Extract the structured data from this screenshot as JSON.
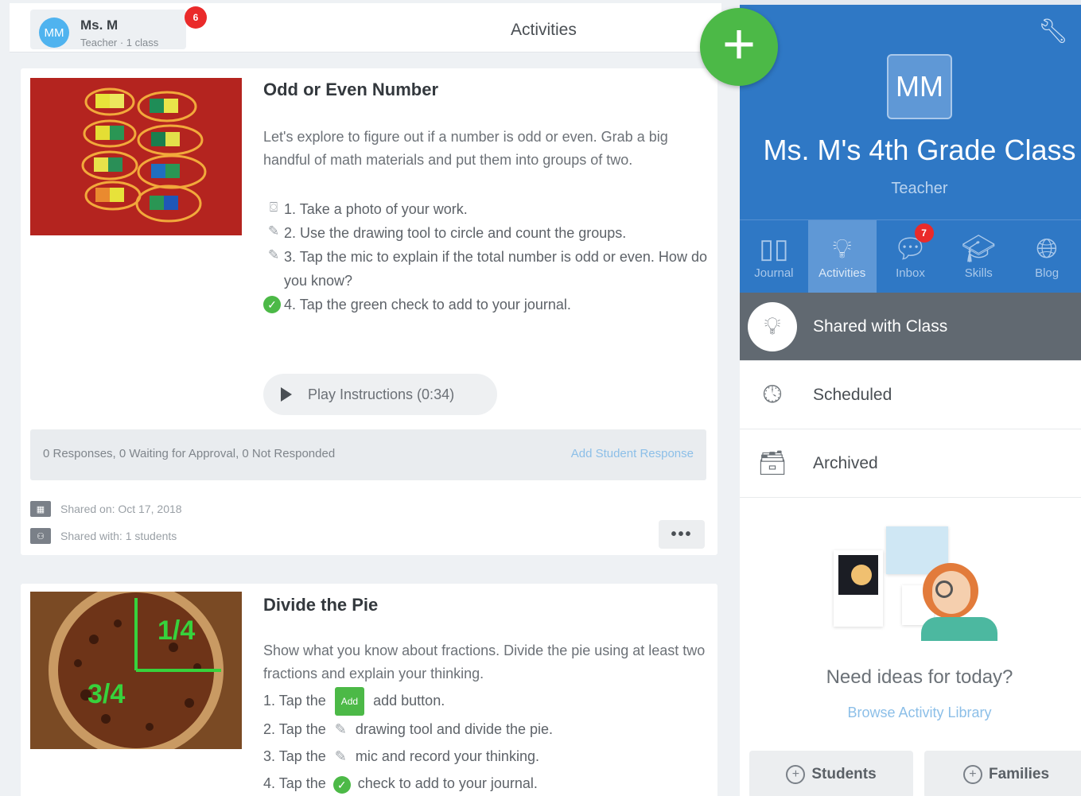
{
  "header": {
    "user_initials": "MM",
    "user_name": "Ms. M",
    "user_subtitle": "Teacher · 1 class",
    "notification_count": "6",
    "page_title": "Activities"
  },
  "fab": {
    "label": "+"
  },
  "activities": [
    {
      "title": "Odd or Even Number",
      "description": "Let's explore to figure out if a number is odd or even. Grab a big handful of math materials and put them into groups of two.",
      "steps": [
        "1. Take a photo of your work.",
        "2. Use the drawing tool to circle and count the groups.",
        "3. Tap the mic to explain if the total number is odd or even. How do you know?",
        "4. Tap the green check to add to your journal."
      ],
      "play_label": "Play Instructions (0:34)",
      "responses_summary": "0 Responses, 0 Waiting for Approval, 0 Not Responded",
      "add_response_label": "Add Student Response",
      "shared_on": "Shared on: Oct 17, 2018",
      "shared_with": "Shared with: 1 students",
      "more_label": "•••"
    },
    {
      "title": "Divide the Pie",
      "description": "Show what you know about fractions. Divide the pie using at least two fractions and explain your thinking.",
      "steps": [
        {
          "pre": "1. Tap the",
          "post": "add button."
        },
        {
          "pre": "2. Tap the",
          "post": "drawing tool and divide the pie."
        },
        {
          "pre": "3. Tap the",
          "post": "mic and record your thinking."
        },
        {
          "pre": "4. Tap the",
          "post": "check to add to your journal."
        }
      ],
      "add_pill": "Add",
      "pie_labels": [
        "1/4",
        "3/4"
      ]
    }
  ],
  "class_panel": {
    "initials": "MM",
    "class_name": "Ms. M's 4th Grade Class",
    "role": "Teacher",
    "nav": [
      {
        "label": "Journal",
        "icon": "book-icon",
        "active": false
      },
      {
        "label": "Activities",
        "icon": "lightbulb-icon",
        "active": true
      },
      {
        "label": "Inbox",
        "icon": "chat-icon",
        "active": false,
        "badge": "7"
      },
      {
        "label": "Skills",
        "icon": "graduation-cap-icon",
        "active": false
      },
      {
        "label": "Blog",
        "icon": "globe-icon",
        "active": false
      }
    ],
    "filters": {
      "shared": "Shared with Class",
      "scheduled": "Scheduled",
      "archived": "Archived"
    },
    "ideas_title": "Need ideas for today?",
    "ideas_link": "Browse Activity Library",
    "students_button": "Students",
    "families_button": "Families"
  },
  "colors": {
    "brand_blue": "#2f78c5",
    "green": "#4cb947",
    "badge_red": "#ea2a2a",
    "active_filter": "#616971"
  }
}
